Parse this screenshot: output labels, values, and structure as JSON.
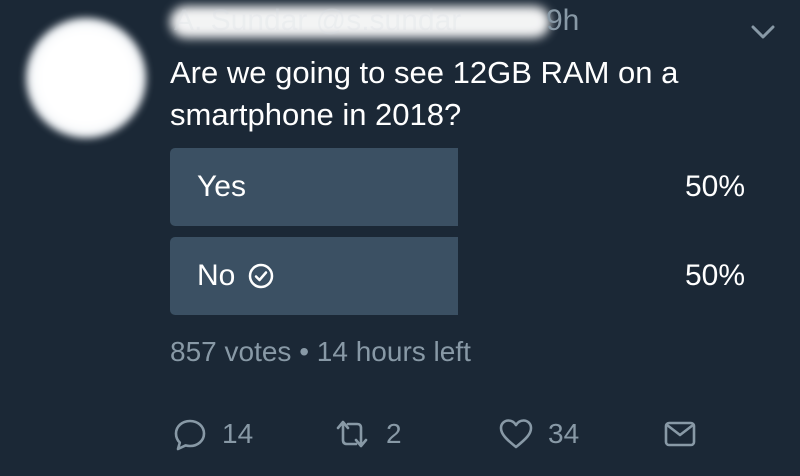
{
  "tweet": {
    "author": "A. Sundar @s.sundar",
    "timestamp": "9h",
    "question": "Are we going to see 12GB RAM on a smartphone in 2018?"
  },
  "poll": {
    "options": [
      {
        "label": "Yes",
        "percent_text": "50%",
        "percent": 50,
        "selected": false
      },
      {
        "label": "No",
        "percent_text": "50%",
        "percent": 50,
        "selected": true
      }
    ],
    "votes": "857 votes",
    "separator": "•",
    "time_left": "14 hours left"
  },
  "actions": {
    "reply_count": "14",
    "retweet_count": "2",
    "like_count": "34"
  },
  "icons": {
    "more": "chevron-down-icon",
    "selected": "check-circle-icon",
    "reply": "reply-icon",
    "retweet": "retweet-icon",
    "like": "heart-icon",
    "dm": "envelope-icon"
  },
  "colors": {
    "background": "#1b2836",
    "poll_bar": "#3b5063",
    "secondary_text": "#8899a6",
    "primary_text": "#ffffff"
  }
}
